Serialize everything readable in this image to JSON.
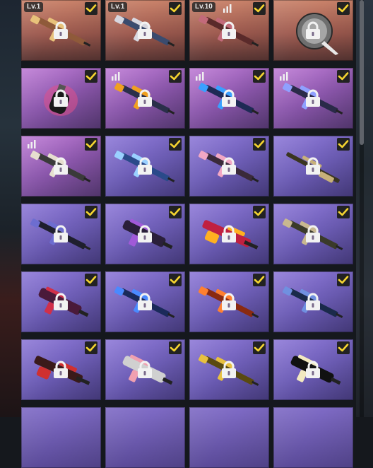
{
  "colors": {
    "orange_tile": "#b06a5b",
    "purple_tile": "#a06ac4",
    "violet_tile": "#7a68c8",
    "checkbox_yellow": "#f5d430",
    "lock_white": "#f2f2f2"
  },
  "icons": {
    "selected": "checkbox-checked-icon",
    "locked": "padlock-icon",
    "upgradeable": "upgrade-bars-icon"
  },
  "items": [
    {
      "tier": "orange",
      "level": "Lv.1",
      "bars": false,
      "kind": "rifle",
      "c1": "#8f5a3a",
      "c2": "#e8c27a",
      "selected": true,
      "locked": true
    },
    {
      "tier": "orange",
      "level": "Lv.1",
      "bars": false,
      "kind": "rifle",
      "c1": "#3a4b6e",
      "c2": "#d7d7e0",
      "selected": true,
      "locked": true
    },
    {
      "tier": "orange",
      "level": "Lv.10",
      "bars": true,
      "kind": "rifle",
      "c1": "#5a2a2a",
      "c2": "#c26a7a",
      "selected": true,
      "locked": true
    },
    {
      "tier": "orange",
      "level": "",
      "bars": false,
      "kind": "pan",
      "c1": "#6e6e6e",
      "c2": "#c9c9c9",
      "selected": true,
      "locked": true
    },
    {
      "tier": "purple",
      "level": "",
      "bars": false,
      "kind": "grenade",
      "c1": "#1a1a1a",
      "c2": "#e0508a",
      "selected": true,
      "locked": true
    },
    {
      "tier": "purple",
      "level": "",
      "bars": true,
      "kind": "rifle",
      "c1": "#2a2f4a",
      "c2": "#f0a020",
      "selected": true,
      "locked": true
    },
    {
      "tier": "purple",
      "level": "",
      "bars": true,
      "kind": "rifle",
      "c1": "#1e2a55",
      "c2": "#3aa0ff",
      "selected": true,
      "locked": true
    },
    {
      "tier": "purple",
      "level": "",
      "bars": true,
      "kind": "rifle",
      "c1": "#2a2a48",
      "c2": "#8fa0ff",
      "selected": true,
      "locked": true
    },
    {
      "tier": "purple",
      "level": "",
      "bars": true,
      "kind": "rifle",
      "c1": "#3a3a3a",
      "c2": "#e6dfcf",
      "selected": true,
      "locked": true
    },
    {
      "tier": "violet",
      "level": "",
      "bars": false,
      "kind": "rifle",
      "c1": "#2a4a8a",
      "c2": "#9ad0ff",
      "selected": true,
      "locked": true
    },
    {
      "tier": "violet",
      "level": "",
      "bars": false,
      "kind": "rifle",
      "c1": "#3a2a3a",
      "c2": "#f2a7c4",
      "selected": true,
      "locked": true
    },
    {
      "tier": "violet",
      "level": "",
      "bars": false,
      "kind": "sniper",
      "c1": "#3a3520",
      "c2": "#c7b07a",
      "selected": true,
      "locked": true
    },
    {
      "tier": "violet",
      "level": "",
      "bars": false,
      "kind": "rifle",
      "c1": "#1f1f2e",
      "c2": "#6d6dd0",
      "selected": true,
      "locked": true
    },
    {
      "tier": "violet",
      "level": "",
      "bars": false,
      "kind": "smg",
      "c1": "#2a1f3a",
      "c2": "#a05ad8",
      "selected": true,
      "locked": true
    },
    {
      "tier": "violet",
      "level": "",
      "bars": false,
      "kind": "lmg",
      "c1": "#c02040",
      "c2": "#ffb020",
      "selected": true,
      "locked": true
    },
    {
      "tier": "violet",
      "level": "",
      "bars": false,
      "kind": "rifle",
      "c1": "#3a3a2a",
      "c2": "#c8b890",
      "selected": true,
      "locked": true
    },
    {
      "tier": "violet",
      "level": "",
      "bars": false,
      "kind": "smg",
      "c1": "#4a1a3a",
      "c2": "#d0304a",
      "selected": true,
      "locked": true
    },
    {
      "tier": "violet",
      "level": "",
      "bars": false,
      "kind": "rifle",
      "c1": "#1a2a5a",
      "c2": "#4a8aff",
      "selected": true,
      "locked": true
    },
    {
      "tier": "violet",
      "level": "",
      "bars": false,
      "kind": "rifle",
      "c1": "#8a2a10",
      "c2": "#ff8030",
      "selected": true,
      "locked": true
    },
    {
      "tier": "violet",
      "level": "",
      "bars": false,
      "kind": "rifle",
      "c1": "#1a2a4a",
      "c2": "#7090e0",
      "selected": true,
      "locked": true
    },
    {
      "tier": "violet",
      "level": "",
      "bars": false,
      "kind": "lmg",
      "c1": "#3a1a1a",
      "c2": "#d03030",
      "selected": true,
      "locked": true
    },
    {
      "tier": "violet",
      "level": "",
      "bars": false,
      "kind": "smg",
      "c1": "#d0d0d0",
      "c2": "#f0a0b0",
      "selected": true,
      "locked": true
    },
    {
      "tier": "violet",
      "level": "",
      "bars": false,
      "kind": "rifle",
      "c1": "#5a4a10",
      "c2": "#e8c040",
      "selected": true,
      "locked": true
    },
    {
      "tier": "violet",
      "level": "",
      "bars": false,
      "kind": "smg",
      "c1": "#111111",
      "c2": "#f2e9c0",
      "selected": true,
      "locked": true
    }
  ],
  "teaser_row_count": 4
}
